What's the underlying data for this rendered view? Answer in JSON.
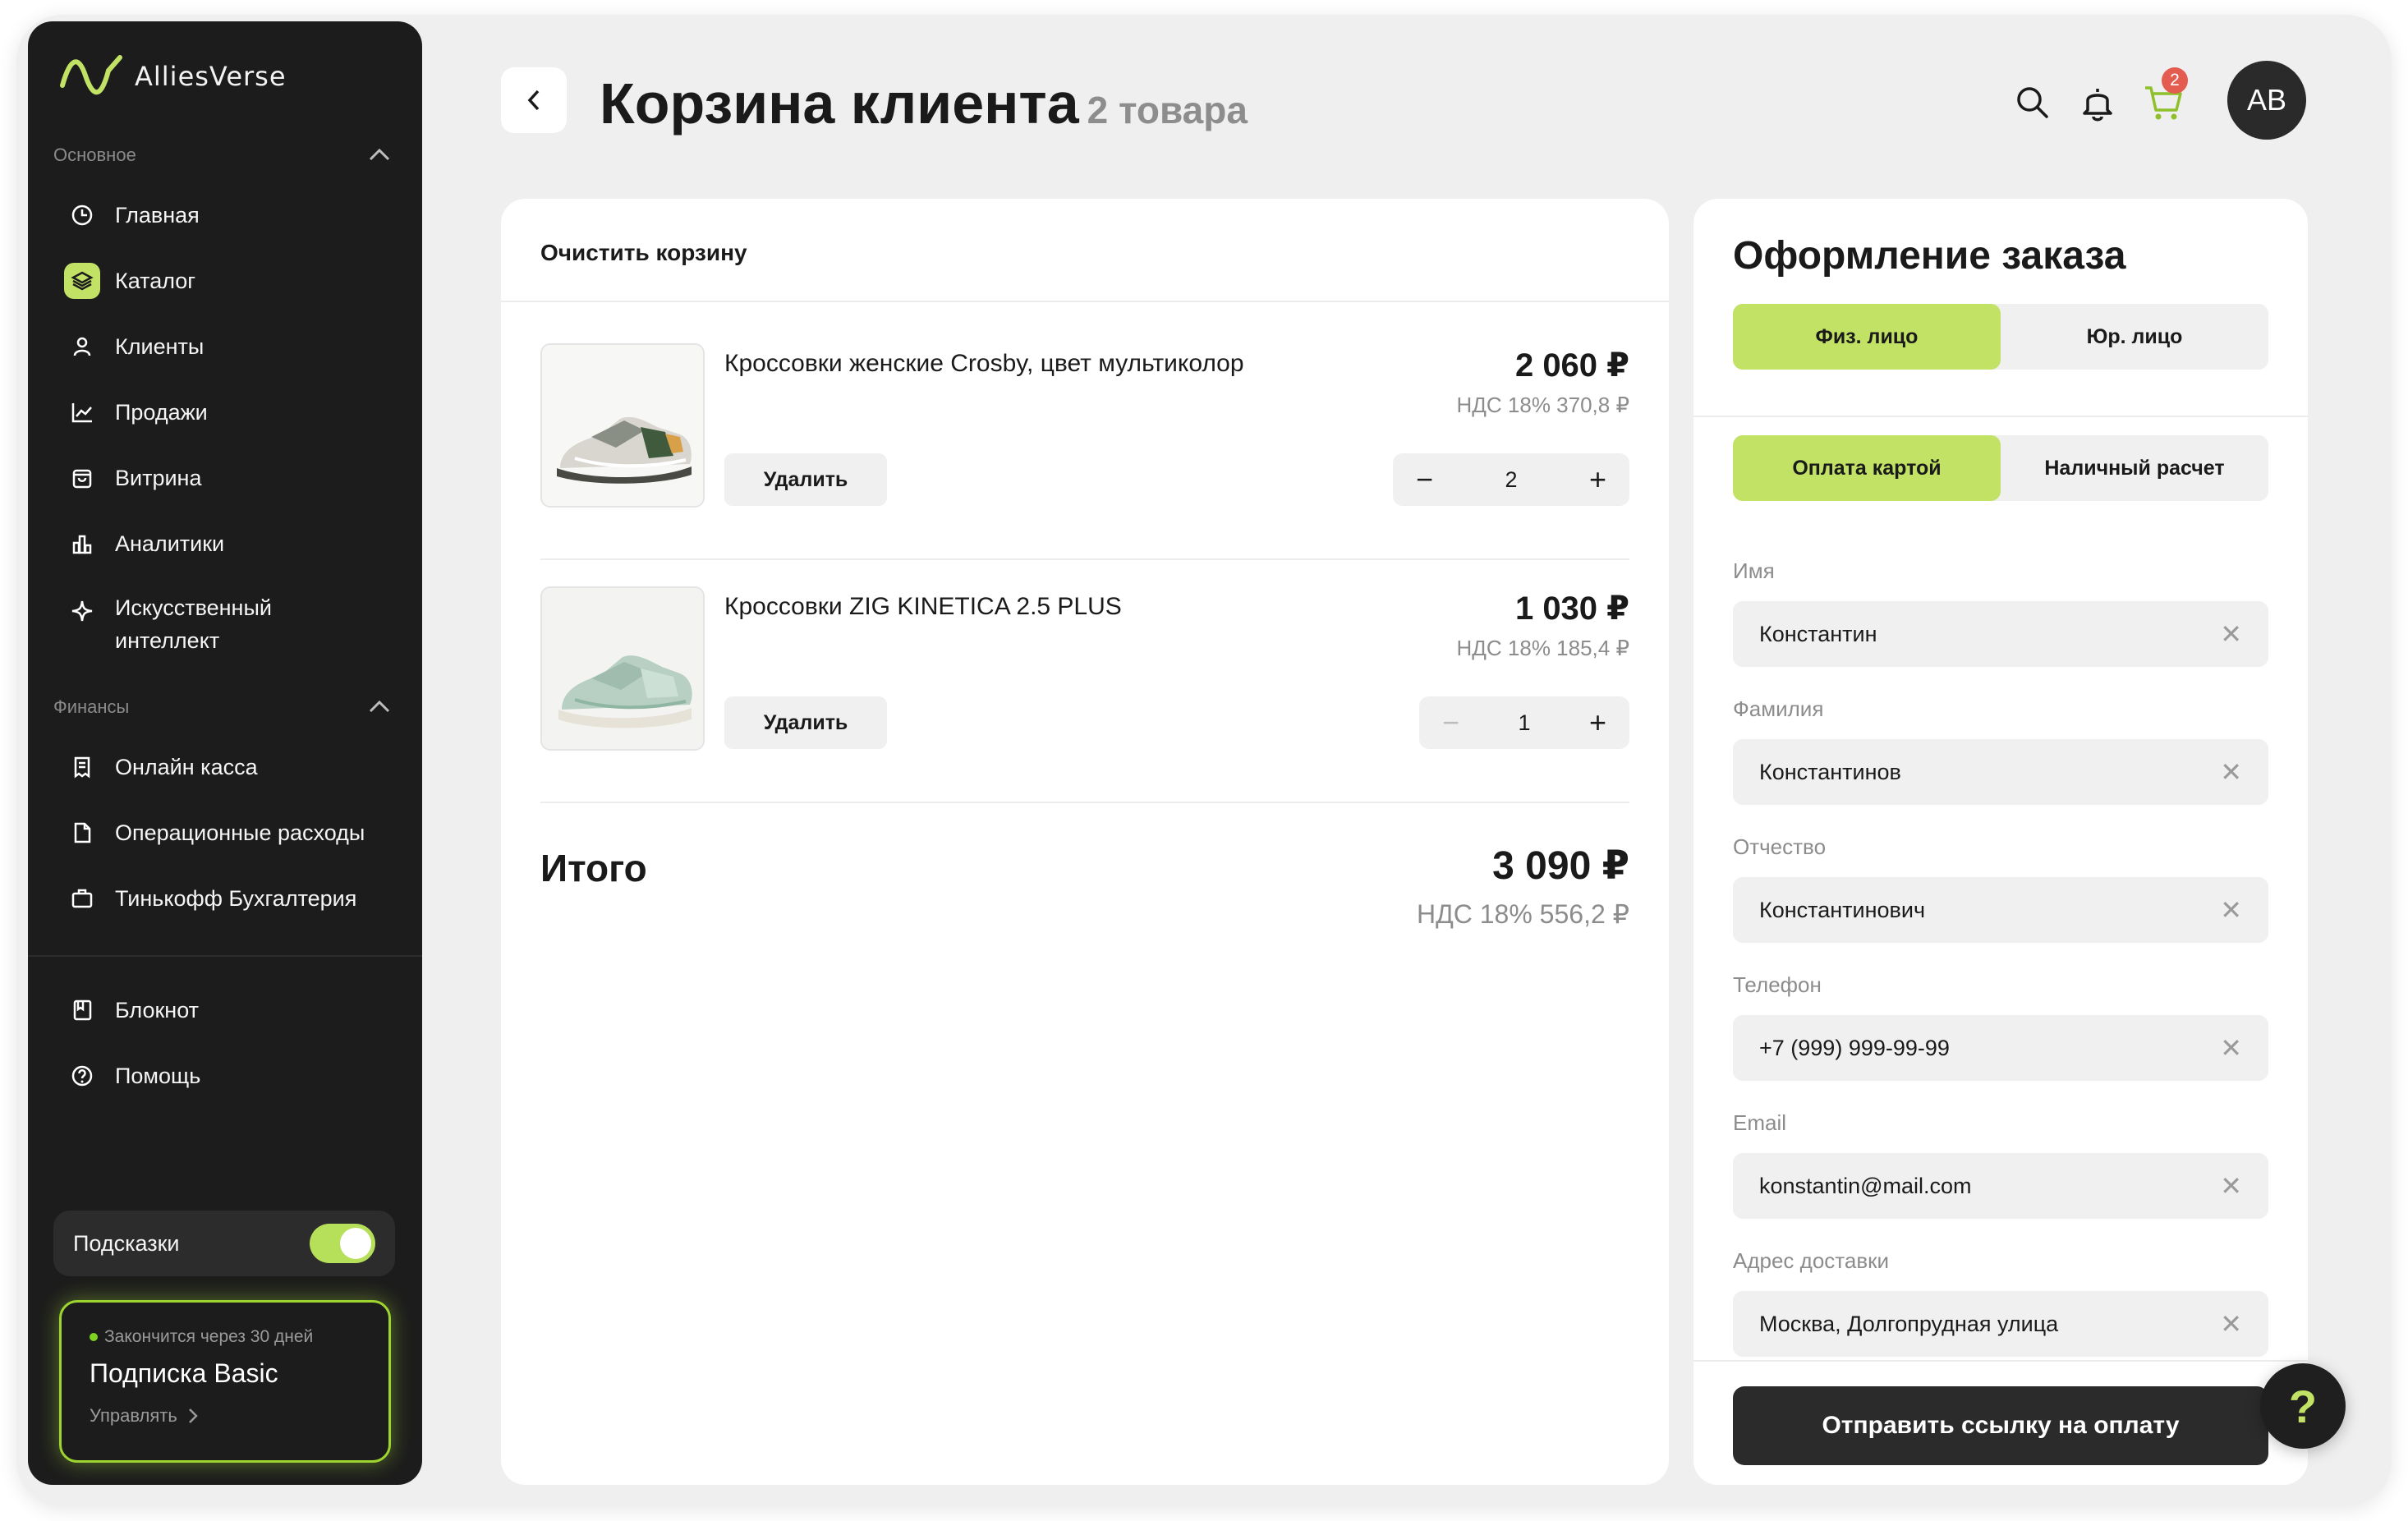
{
  "app": {
    "name": "AlliesVerse"
  },
  "colors": {
    "accent": "#c1e264",
    "dark": "#1c1c1c",
    "danger": "#e45b4f"
  },
  "sidebar": {
    "section_main": "Основное",
    "section_finance": "Финансы",
    "main_items": [
      {
        "label": "Главная",
        "icon": "clock-icon"
      },
      {
        "label": "Каталог",
        "icon": "layers-icon",
        "active": true
      },
      {
        "label": "Клиенты",
        "icon": "user-icon"
      },
      {
        "label": "Продажи",
        "icon": "chart-line-icon"
      },
      {
        "label": "Витрина",
        "icon": "bag-icon"
      },
      {
        "label": "Аналитики",
        "icon": "bar-chart-icon"
      },
      {
        "label": "Искусственный интеллект",
        "label_line1": "Искусственный",
        "label_line2": "интеллект",
        "icon": "sparkle-icon"
      }
    ],
    "finance_items": [
      {
        "label": "Онлайн касса",
        "icon": "receipt-icon"
      },
      {
        "label": "Операционные расходы",
        "icon": "document-icon"
      },
      {
        "label": "Тинькофф Бухгалтерия",
        "icon": "briefcase-icon"
      }
    ],
    "bottom_items": [
      {
        "label": "Блокнот",
        "icon": "notebook-icon"
      },
      {
        "label": "Помощь",
        "icon": "help-circle-icon"
      }
    ],
    "hints_label": "Подсказки",
    "hints_enabled": true,
    "subscription": {
      "status": "Закончится через 30 дней",
      "title": "Подписка Basic",
      "manage": "Управлять"
    }
  },
  "header": {
    "title": "Корзина клиента",
    "count": "2 товара",
    "cart_badge": "2",
    "avatar": "AB"
  },
  "cart": {
    "clear_label": "Очистить корзину",
    "remove_label": "Удалить",
    "items": [
      {
        "name": "Кроссовки женские Crosby, цвет мультиколор",
        "price": "2 060 ₽",
        "vat": "НДС 18% 370,8 ₽",
        "qty": "2"
      },
      {
        "name": "Кроссовки ZIG KINETICA 2.5 PLUS",
        "price": "1 030 ₽",
        "vat": "НДС 18% 185,4 ₽",
        "qty": "1"
      }
    ],
    "total_label": "Итого",
    "total_price": "3 090 ₽",
    "total_vat": "НДС 18% 556,2 ₽"
  },
  "order": {
    "title": "Оформление заказа",
    "person_types": [
      "Физ. лицо",
      "Юр. лицо"
    ],
    "payment_types": [
      "Оплата картой",
      "Наличный расчет"
    ],
    "fields": [
      {
        "label": "Имя",
        "value": "Константин"
      },
      {
        "label": "Фамилия",
        "value": "Константинов"
      },
      {
        "label": "Отчество",
        "value": "Константинович"
      },
      {
        "label": "Телефон",
        "value": "+7 (999) 999-99-99"
      },
      {
        "label": "Email",
        "value": "konstantin@mail.com"
      },
      {
        "label": "Адрес доставки",
        "value": "Москва, Долгопрудная улица"
      }
    ],
    "submit_label": "Отправить ссылку на оплату"
  },
  "help_fab": "?"
}
